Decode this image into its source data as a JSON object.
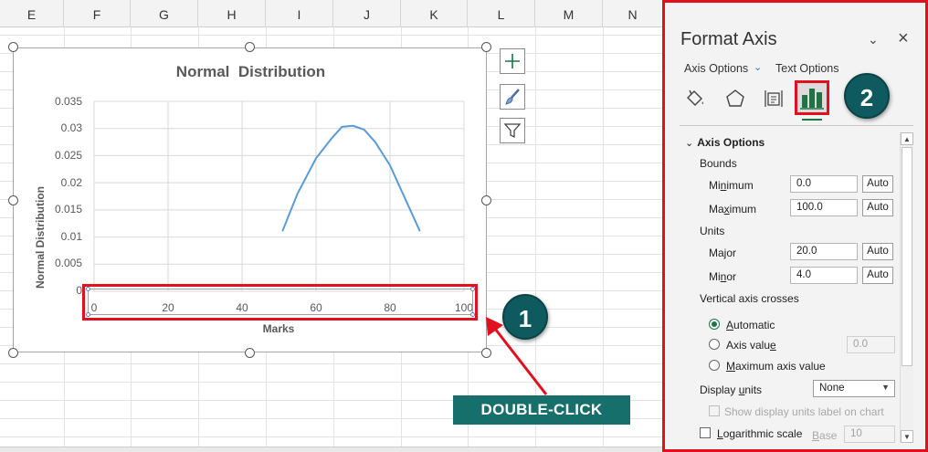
{
  "sheet": {
    "columns": [
      "E",
      "F",
      "G",
      "H",
      "I",
      "J",
      "K",
      "L",
      "M",
      "N"
    ]
  },
  "chart": {
    "title": "Normal  Distribution",
    "y_title": "Normal Distribution",
    "x_title": "Marks"
  },
  "chart_data": {
    "type": "line",
    "title": "Normal  Distribution",
    "xlabel": "Marks",
    "ylabel": "Normal Distribution",
    "xlim": [
      0,
      100
    ],
    "ylim": [
      0,
      0.035
    ],
    "x_ticks": [
      "0",
      "20",
      "40",
      "60",
      "80",
      "100"
    ],
    "y_ticks": [
      "0",
      "0.005",
      "0.01",
      "0.015",
      "0.02",
      "0.025",
      "0.03",
      "0.035"
    ],
    "grid": true,
    "color": "#5b9bd5",
    "series": [
      {
        "x": [
          51,
          55,
          60,
          64,
          67,
          70,
          73,
          76,
          80,
          84,
          88
        ],
        "values": [
          0.0112,
          0.018,
          0.0245,
          0.028,
          0.0303,
          0.0305,
          0.0298,
          0.0275,
          0.0232,
          0.0172,
          0.0112
        ]
      }
    ]
  },
  "callouts": {
    "step1": "1",
    "step2": "2",
    "double_click": "DOUBLE-CLICK"
  },
  "pane": {
    "title": "Format Axis",
    "tab_axis_options": "Axis Options",
    "tab_text_options": "Text Options",
    "section_axis_options": "Axis Options",
    "bounds_label": "Bounds",
    "minimum_label_pre": "Mi",
    "minimum_label_u": "n",
    "minimum_label_post": "imum",
    "minimum_value": "0.0",
    "maximum_label_pre": "Ma",
    "maximum_label_u": "x",
    "maximum_label_post": "imum",
    "maximum_value": "100.0",
    "units_label": "Units",
    "major_label_pre": "Ma",
    "major_label_u": "j",
    "major_label_post": "or",
    "major_value": "20.0",
    "minor_label_pre": "Mi",
    "minor_label_u": "n",
    "minor_label_post": "or",
    "minor_value": "4.0",
    "auto_label": "Auto",
    "vertical_axis_crosses": "Vertical axis crosses",
    "automatic_pre": "",
    "automatic_u": "A",
    "automatic_post": "utomatic",
    "axis_value_pre": "Axis valu",
    "axis_value_u": "e",
    "axis_value_post": "",
    "axis_value_field": "0.0",
    "maximum_axis_value_pre": "",
    "maximum_axis_value_u": "M",
    "maximum_axis_value_post": "aximum axis value",
    "display_units_pre": "Display ",
    "display_units_u": "u",
    "display_units_post": "nits",
    "display_units_value": "None",
    "show_label": "Show display units label on chart",
    "log_scale_pre": "",
    "log_scale_u": "L",
    "log_scale_post": "ogarithmic scale",
    "base_pre": "",
    "base_u": "B",
    "base_post": "ase",
    "base_value": "10"
  },
  "colors": {
    "highlight": "#e0101e",
    "badge": "#0f5a5f",
    "label_bg": "#176f6b",
    "excel_green": "#217346",
    "series": "#5b9bd5"
  },
  "icons": {
    "chart_elements": "plus-icon",
    "chart_styles": "paintbrush-icon",
    "chart_filters": "funnel-icon",
    "fill_line": "paint-bucket-icon",
    "effects": "pentagon-icon",
    "size_properties": "size-properties-icon",
    "axis_options": "bar-chart-icon"
  }
}
